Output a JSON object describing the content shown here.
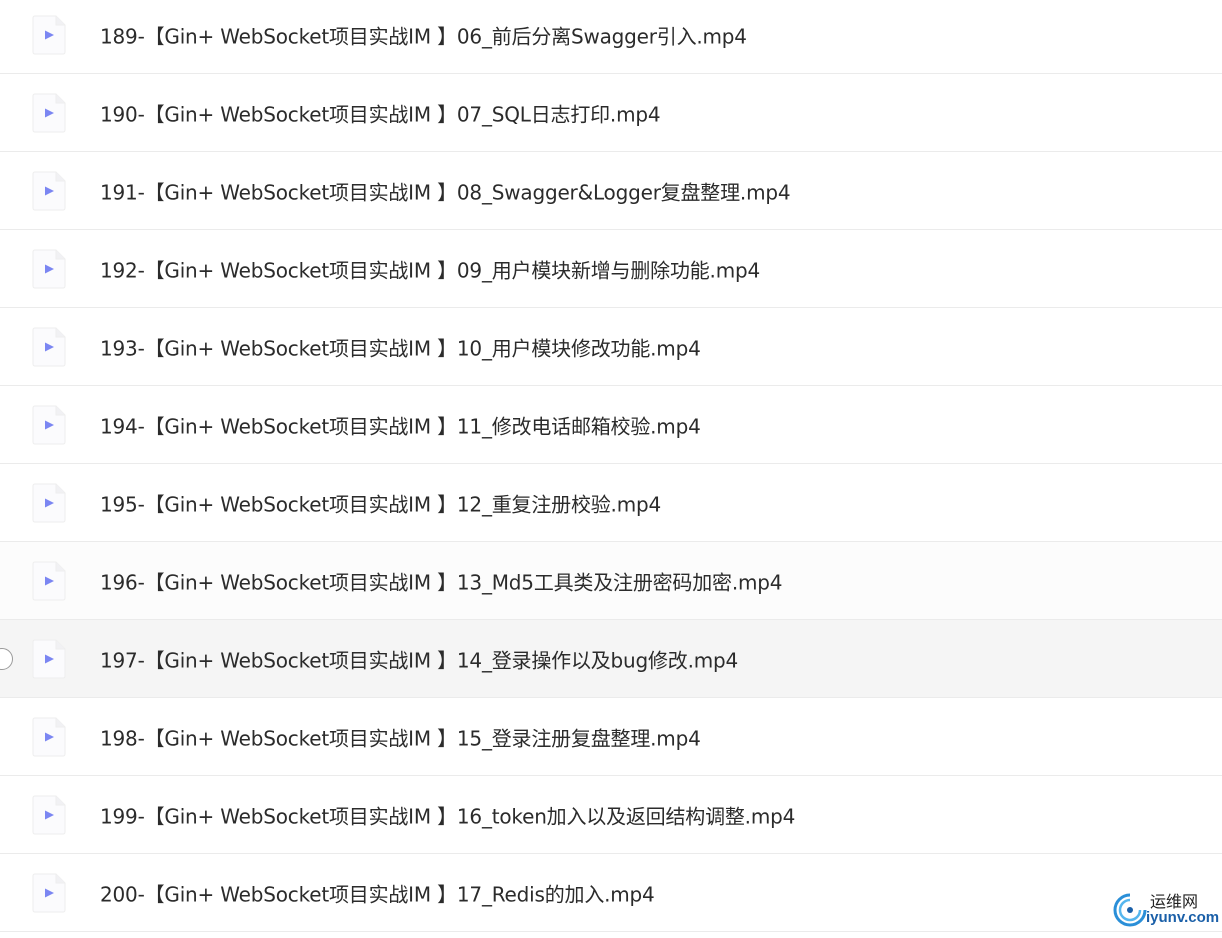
{
  "files": [
    {
      "name": "189-【Gin+ WebSocket项目实战IM 】06_前后分离Swagger引入.mp4",
      "state": "normal"
    },
    {
      "name": "190-【Gin+ WebSocket项目实战IM 】07_SQL日志打印.mp4",
      "state": "normal"
    },
    {
      "name": "191-【Gin+ WebSocket项目实战IM 】08_Swagger&Logger复盘整理.mp4",
      "state": "normal"
    },
    {
      "name": "192-【Gin+ WebSocket项目实战IM 】09_用户模块新增与删除功能.mp4",
      "state": "normal"
    },
    {
      "name": "193-【Gin+ WebSocket项目实战IM 】10_用户模块修改功能.mp4",
      "state": "normal"
    },
    {
      "name": "194-【Gin+ WebSocket项目实战IM 】11_修改电话邮箱校验.mp4",
      "state": "normal"
    },
    {
      "name": "195-【Gin+ WebSocket项目实战IM 】12_重复注册校验.mp4",
      "state": "normal"
    },
    {
      "name": "196-【Gin+ WebSocket项目实战IM 】13_Md5工具类及注册密码加密.mp4",
      "state": "light"
    },
    {
      "name": "197-【Gin+ WebSocket项目实战IM 】14_登录操作以及bug修改.mp4",
      "state": "hovered"
    },
    {
      "name": "198-【Gin+ WebSocket项目实战IM 】15_登录注册复盘整理.mp4",
      "state": "normal"
    },
    {
      "name": "199-【Gin+ WebSocket项目实战IM 】16_token加入以及返回结构调整.mp4",
      "state": "normal"
    },
    {
      "name": "200-【Gin+ WebSocket项目实战IM 】17_Redis的加入.mp4",
      "state": "normal"
    }
  ],
  "icon": "video-file-icon",
  "colors": {
    "play_triangle": "#7b86f2",
    "icon_bg": "#fbfbfd",
    "text": "#2b2b2b",
    "hover_row": "#f5f5f5",
    "divider": "#ebebeb"
  },
  "watermark": {
    "cn": "运维网",
    "en": "iyunv.com"
  }
}
